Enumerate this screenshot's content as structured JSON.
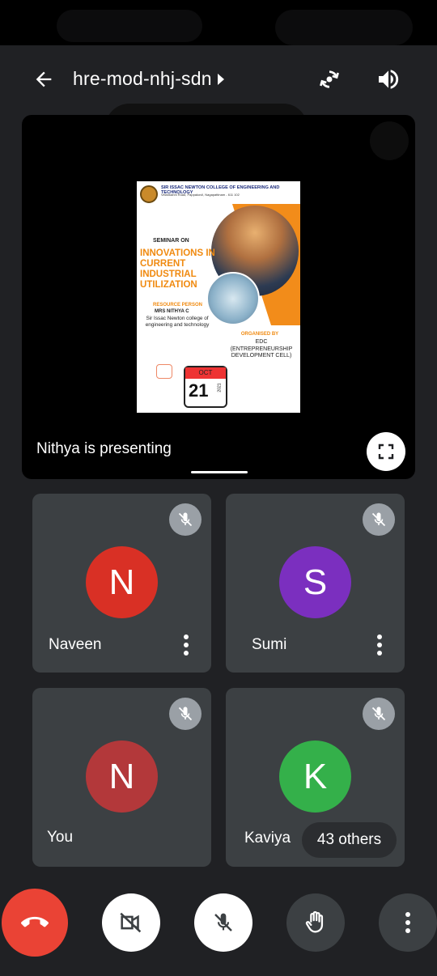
{
  "meeting": {
    "code": "hre-mod-nhj-sdn",
    "presenting_text": "Nithya is presenting"
  },
  "poster": {
    "college": "SIR ISSAC NEWTON COLLEGE OF ENGINEERING AND TECHNOLOGY",
    "address": "Velankanni Road, Pappakovil, Nagapattinam - 611 102",
    "seminar_label": "SEMINAR ON",
    "seminar_title": "INNOVATIONS IN CURRENT INDUSTRIAL UTILIZATION",
    "resource_label": "RESOURCE PERSON",
    "resource_name": "MRS NITHYA C",
    "resource_college": "Sir Issac Newton college of engineering and technology",
    "organised_label": "ORGANISED BY",
    "organised_by": "EDC (ENTREPRENEURSHIP DEVELOPMENT CELL)",
    "month": "OCT",
    "day": "21",
    "year": "2021"
  },
  "participants": [
    {
      "name": "Naveen",
      "initial": "N",
      "color": "#d93025"
    },
    {
      "name": "Sumi",
      "initial": "S",
      "color": "#7b2fbf"
    },
    {
      "name": "You",
      "initial": "N",
      "color": "#b3383a"
    },
    {
      "name": "Kaviya",
      "initial": "K",
      "color": "#34b04a"
    }
  ],
  "others_label": "43 others",
  "colors": {
    "background": "#202124",
    "tile": "#3c4043",
    "end_call": "#ea4335"
  },
  "icons": [
    "back-arrow-icon",
    "dropdown-arrow-icon",
    "switch-camera-icon",
    "speaker-icon",
    "fullscreen-icon",
    "mic-off-icon",
    "more-vert-icon",
    "end-call-icon",
    "camera-off-icon",
    "raise-hand-icon"
  ]
}
